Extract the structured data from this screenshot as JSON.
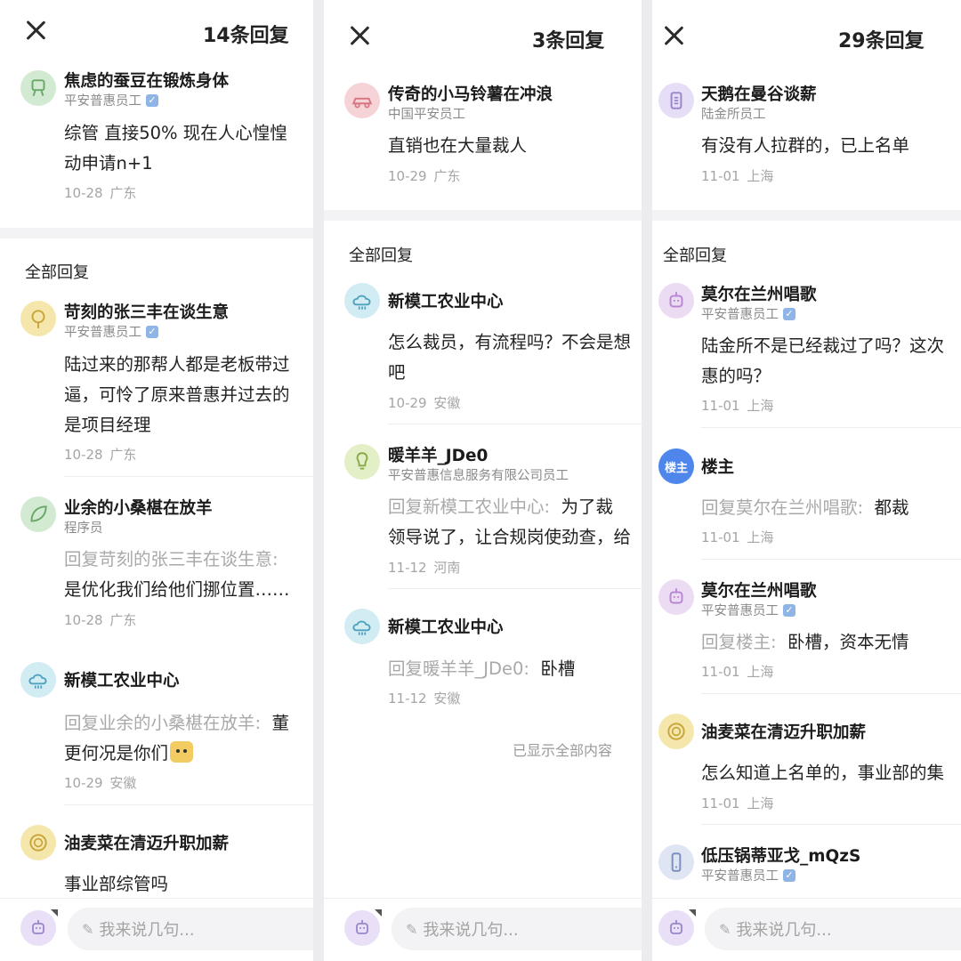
{
  "panels": [
    {
      "reply_count": "14条回复",
      "original": {
        "name": "焦虑的蚕豆在锻炼身体",
        "role": "平安普惠员工",
        "verified": true,
        "text_lines": [
          "综管 直接50% 现在人心惶惶",
          "动申请n+1"
        ],
        "date": "10-28",
        "location": "广东",
        "avatar": {
          "bg": "#d3ead2",
          "icon": "toy-icon"
        }
      },
      "section_title": "全部回复",
      "replies": [
        {
          "name": "苛刻的张三丰在谈生意",
          "role": "平安普惠员工",
          "verified": true,
          "reply_to": "",
          "text_lines": [
            "陆过来的那帮人都是老板带过",
            "逼，可怜了原来普惠并过去的",
            "是项目经理"
          ],
          "date": "10-28",
          "location": "广东",
          "avatar": {
            "bg": "#f5e7ac",
            "icon": "flower-icon"
          }
        },
        {
          "name": "业余的小桑椹在放羊",
          "role": "程序员",
          "verified": false,
          "reply_to": "回复苛刻的张三丰在谈生意:",
          "text_lines": [
            "是优化我们给他们挪位置……"
          ],
          "date": "10-28",
          "location": "广东",
          "avatar": {
            "bg": "#d3ead2",
            "icon": "leaf-icon"
          }
        },
        {
          "name": "新模工农业中心",
          "role": "",
          "verified": false,
          "reply_to": "回复业余的小桑椹在放羊:",
          "reply_tail": "董",
          "text_lines": [
            "更何况是你们"
          ],
          "emoji": true,
          "date": "10-29",
          "location": "安徽",
          "avatar": {
            "bg": "#d2ecf4",
            "icon": "cloud-icon"
          }
        },
        {
          "name": "油麦菜在清迈升职加薪",
          "role": "",
          "verified": false,
          "reply_to": "",
          "text_lines": [
            "事业部综管吗"
          ],
          "date": "",
          "location": "",
          "avatar": {
            "bg": "#f5e7ac",
            "icon": "lion-icon"
          }
        }
      ],
      "input_placeholder": "我来说几句..."
    },
    {
      "reply_count": "3条回复",
      "original": {
        "name": "传奇的小马铃薯在冲浪",
        "role": "中国平安员工",
        "verified": false,
        "text_lines": [
          "直销也在大量裁人"
        ],
        "date": "10-29",
        "location": "广东",
        "avatar": {
          "bg": "#f6d3d6",
          "icon": "car-icon"
        }
      },
      "section_title": "全部回复",
      "replies": [
        {
          "name": "新模工农业中心",
          "role": "",
          "verified": false,
          "reply_to": "",
          "text_lines": [
            "怎么裁员，有流程吗？不会是想",
            "吧"
          ],
          "date": "10-29",
          "location": "安徽",
          "avatar": {
            "bg": "#d2ecf4",
            "icon": "cloud-icon"
          }
        },
        {
          "name": "暖羊羊_JDe0",
          "role": "平安普惠信息服务有限公司员工",
          "verified": false,
          "reply_to": "回复新模工农业中心:",
          "reply_tail": "为了裁",
          "text_lines": [
            "领导说了，让合规岗使劲查，给"
          ],
          "date": "11-12",
          "location": "河南",
          "avatar": {
            "bg": "#e3efc6",
            "icon": "bulb-icon"
          }
        },
        {
          "name": "新模工农业中心",
          "role": "",
          "verified": false,
          "reply_to": "回复暖羊羊_JDe0:",
          "reply_tail": "卧槽",
          "text_lines": [],
          "date": "11-12",
          "location": "安徽",
          "avatar": {
            "bg": "#d2ecf4",
            "icon": "cloud-icon"
          }
        }
      ],
      "all_shown": "已显示全部内容",
      "input_placeholder": "我来说几句..."
    },
    {
      "reply_count": "29条回复",
      "original": {
        "name": "天鹅在曼谷谈薪",
        "role": "陆金所员工",
        "verified": false,
        "text_lines": [
          "有没有人拉群的，已上名单"
        ],
        "date": "11-01",
        "location": "上海",
        "avatar": {
          "bg": "#e6def6",
          "icon": "scroll-icon"
        }
      },
      "section_title": "全部回复",
      "replies": [
        {
          "name": "莫尔在兰州唱歌",
          "role": "平安普惠员工",
          "verified": true,
          "reply_to": "",
          "text_lines": [
            "陆金所不是已经裁过了吗？这次",
            "惠的吗？"
          ],
          "date": "11-01",
          "location": "上海",
          "avatar": {
            "bg": "#ecdcf3",
            "icon": "robot-icon"
          }
        },
        {
          "name": "楼主",
          "role": "",
          "verified": false,
          "is_op": true,
          "op_badge": "楼主",
          "reply_to": "回复莫尔在兰州唱歌:",
          "reply_tail": "都裁",
          "text_lines": [],
          "date": "11-01",
          "location": "上海",
          "avatar": {
            "bg": "#4f86ec",
            "icon": "op-badge"
          }
        },
        {
          "name": "莫尔在兰州唱歌",
          "role": "平安普惠员工",
          "verified": true,
          "reply_to": "回复楼主:",
          "reply_tail": "卧槽，资本无情",
          "text_lines": [],
          "date": "11-01",
          "location": "上海",
          "avatar": {
            "bg": "#ecdcf3",
            "icon": "robot-icon"
          }
        },
        {
          "name": "油麦菜在清迈升职加薪",
          "role": "",
          "verified": false,
          "reply_to": "",
          "text_lines": [
            "怎么知道上名单的，事业部的集"
          ],
          "date": "11-01",
          "location": "上海",
          "avatar": {
            "bg": "#f5e7ac",
            "icon": "lion-icon"
          }
        },
        {
          "name": "低压锅蒂亚戈_mQzS",
          "role": "平安普惠员工",
          "verified": true,
          "reply_to": "",
          "text_lines": [],
          "date": "",
          "location": "",
          "avatar": {
            "bg": "#dfe5f3",
            "icon": "phone-icon"
          }
        }
      ],
      "input_placeholder": "我来说几句..."
    }
  ],
  "verify_glyph": "✓",
  "pencil_glyph": "✎"
}
